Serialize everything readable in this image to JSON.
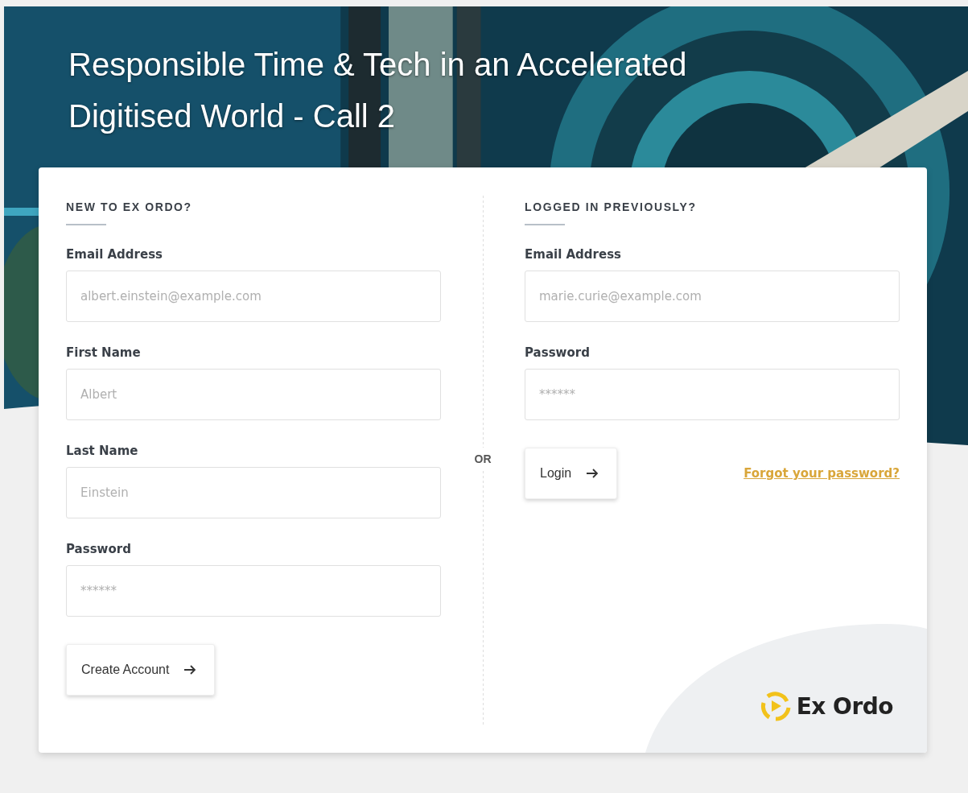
{
  "page_title": "Responsible Time & Tech in an Accelerated Digitised World - Call 2",
  "register": {
    "heading": "NEW TO EX ORDO?",
    "fields": [
      {
        "label": "Email Address",
        "placeholder": "albert.einstein@example.com"
      },
      {
        "label": "First Name",
        "placeholder": "Albert"
      },
      {
        "label": "Last Name",
        "placeholder": "Einstein"
      },
      {
        "label": "Password",
        "placeholder": "******"
      }
    ],
    "button": "Create Account"
  },
  "divider": "OR",
  "login": {
    "heading": "LOGGED IN PREVIOUSLY?",
    "fields": [
      {
        "label": "Email Address",
        "placeholder": "marie.curie@example.com"
      },
      {
        "label": "Password",
        "placeholder": "******"
      }
    ],
    "button": "Login",
    "link": "Forgot your password?"
  },
  "logo": {
    "text": "Ex Ordo"
  }
}
